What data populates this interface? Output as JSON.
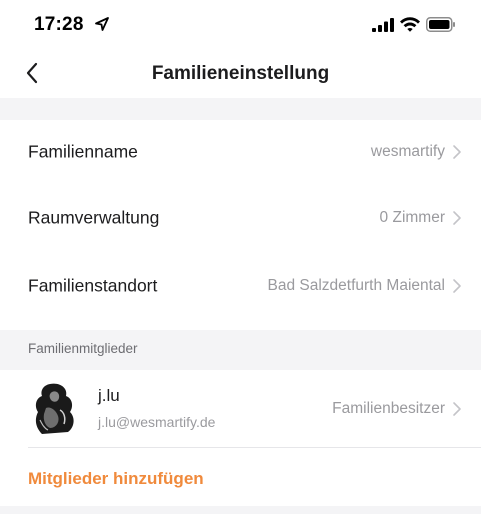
{
  "status_bar": {
    "time": "17:28",
    "location_icon": "location-arrow-icon",
    "signal_icon": "cellular-signal-icon",
    "wifi_icon": "wifi-icon",
    "battery_icon": "battery-icon"
  },
  "nav": {
    "title": "Familieneinstellung",
    "back_icon": "chevron-left-icon"
  },
  "settings": [
    {
      "label": "Familienname",
      "value": "wesmartify"
    },
    {
      "label": "Raumverwaltung",
      "value": "0 Zimmer"
    },
    {
      "label": "Familienstandort",
      "value": "Bad Salzdetfurth Maiental"
    }
  ],
  "members_section": {
    "header": "Familienmitglieder",
    "members": [
      {
        "name": "j.lu",
        "email": "j.lu@wesmartify.de",
        "role": "Familienbesitzer"
      }
    ],
    "add_label": "Mitglieder hinzufügen"
  },
  "colors": {
    "accent": "#f08a3c",
    "secondary_text": "#9a9a9e",
    "band": "#f4f4f6"
  }
}
